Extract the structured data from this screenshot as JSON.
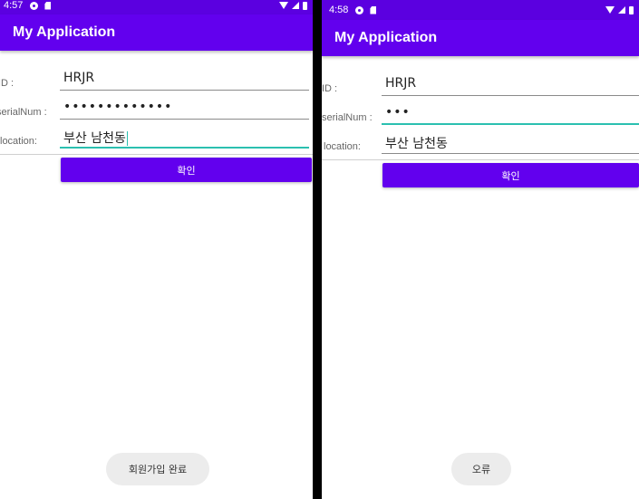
{
  "left": {
    "status": {
      "time": "4:57"
    },
    "app_title": "My Application",
    "fields": {
      "id": {
        "label": "ID :",
        "value": "HRJR"
      },
      "serial": {
        "label": "serialNum :",
        "value": "•••••••••••••"
      },
      "location": {
        "label": "location:",
        "value": "부산 남천동"
      }
    },
    "confirm_label": "확인",
    "toast": "회원가입 완료"
  },
  "right": {
    "status": {
      "time": "4:58"
    },
    "app_title": "My Application",
    "fields": {
      "id": {
        "label": "ID :",
        "value": "HRJR"
      },
      "serial": {
        "label": "serialNum :",
        "value": "•••"
      },
      "location": {
        "label": "location:",
        "value": "부산 남천동"
      }
    },
    "confirm_label": "확인",
    "toast": "오류"
  },
  "colors": {
    "primary": "#6200ee",
    "status_bar": "#5b00e0",
    "focus_accent": "#2bc0b0",
    "toast_bg": "#ececec"
  },
  "icons": [
    "app-notification-icon",
    "sd-card-icon",
    "wifi-icon",
    "signal-icon",
    "battery-icon"
  ]
}
